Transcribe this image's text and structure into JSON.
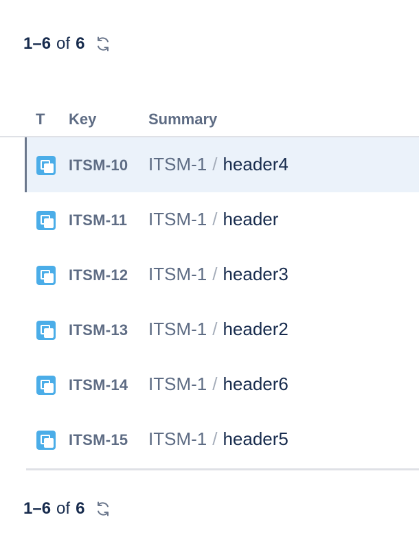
{
  "pagination": {
    "range": "1–6",
    "of_label": "of",
    "total": "6"
  },
  "columns": {
    "type": "T",
    "key": "Key",
    "summary": "Summary"
  },
  "separator": "/",
  "icons": {
    "refresh": "refresh-icon",
    "issue_type": "subtask-icon"
  },
  "colors": {
    "selected_row_bg": "#ebf2fa",
    "issue_icon": "#4bade8",
    "text_primary": "#172b4d",
    "text_secondary": "#5e6c84"
  },
  "rows": [
    {
      "key": "ITSM-10",
      "parent": "ITSM-1",
      "title": "header4",
      "selected": true
    },
    {
      "key": "ITSM-11",
      "parent": "ITSM-1",
      "title": "header",
      "selected": false
    },
    {
      "key": "ITSM-12",
      "parent": "ITSM-1",
      "title": "header3",
      "selected": false
    },
    {
      "key": "ITSM-13",
      "parent": "ITSM-1",
      "title": "header2",
      "selected": false
    },
    {
      "key": "ITSM-14",
      "parent": "ITSM-1",
      "title": "header6",
      "selected": false
    },
    {
      "key": "ITSM-15",
      "parent": "ITSM-1",
      "title": "header5",
      "selected": false
    }
  ]
}
